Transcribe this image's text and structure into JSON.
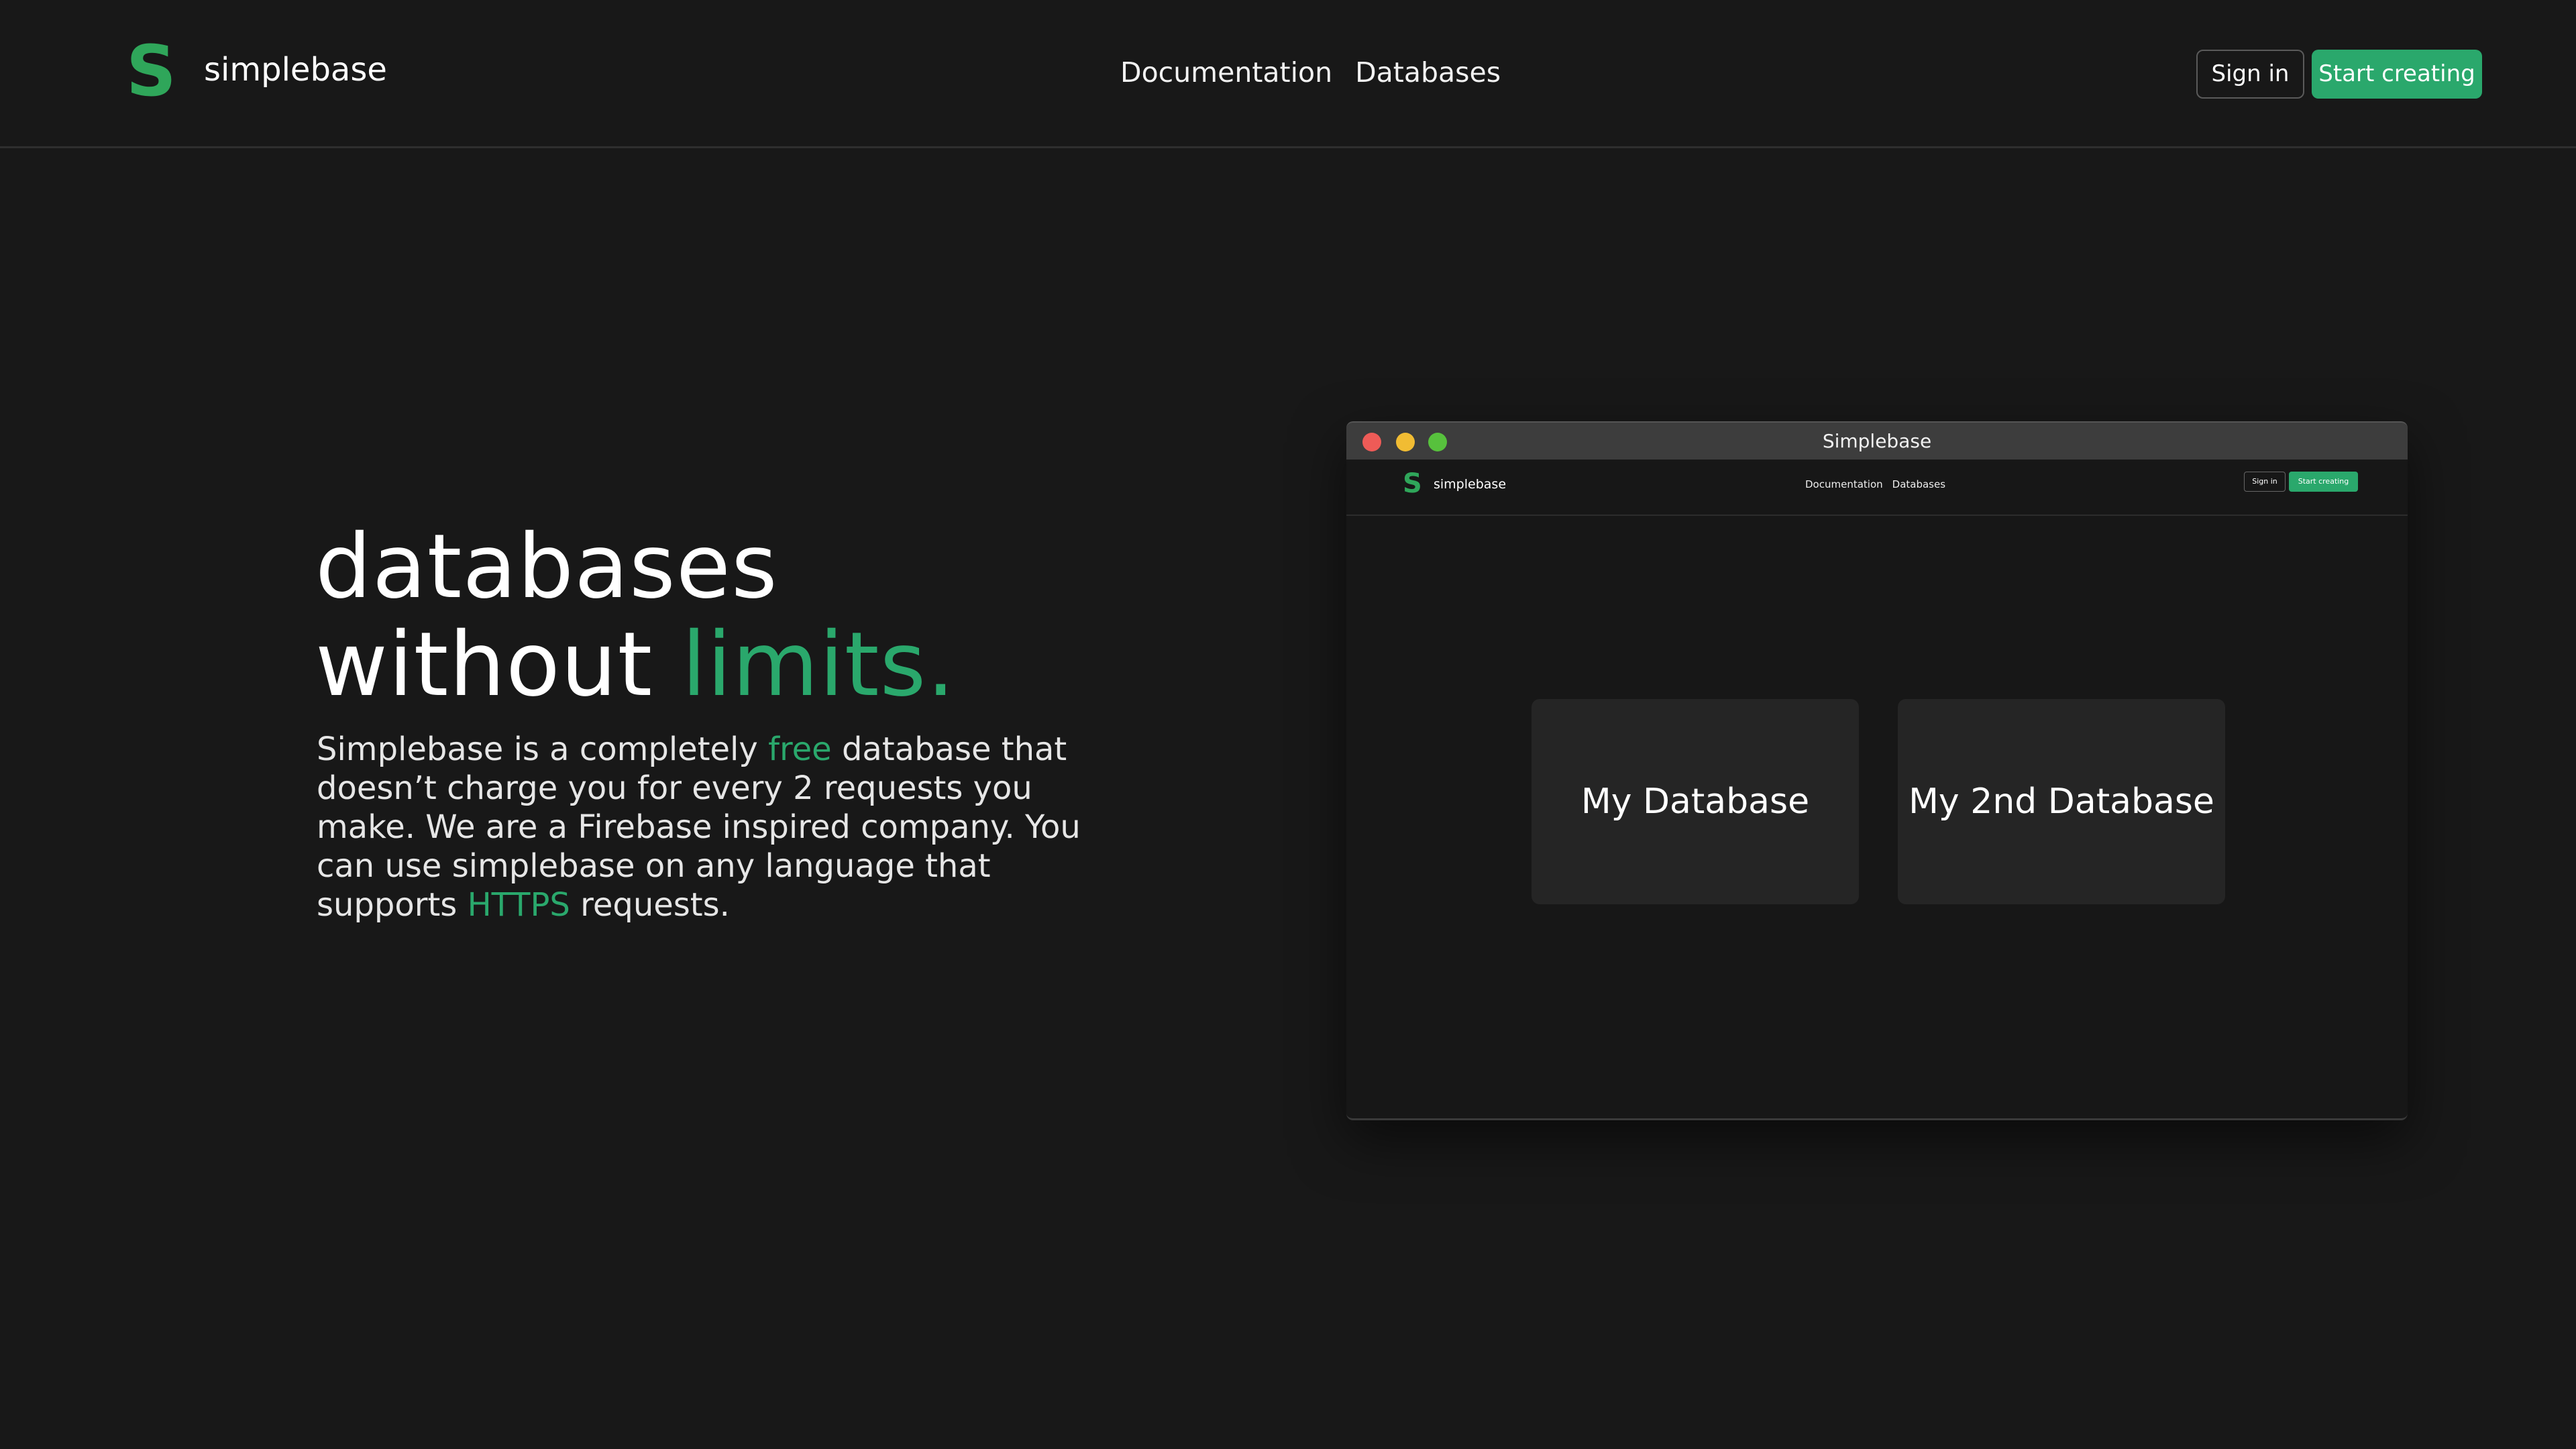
{
  "nav": {
    "logo_mark": "S",
    "brand": "simplebase",
    "links": [
      "Documentation",
      "Databases"
    ],
    "sign_in": "Sign in",
    "start_creating": "Start creating"
  },
  "hero": {
    "title_line1": "databases",
    "title_line2_prefix": "without ",
    "title_line2_accent": "limits.",
    "desc_part1": "Simplebase is a completely ",
    "desc_free": "free",
    "desc_part2": " database that doesn’t charge you for every 2 requests you make. We are a Firebase inspired company. You can use simplebase on any language that supports ",
    "desc_https": "HTTPS",
    "desc_part3": " requests."
  },
  "mockup": {
    "window_title": "Simplebase",
    "nav": {
      "logo_mark": "S",
      "brand": "simplebase",
      "links": [
        "Documentation",
        "Databases"
      ],
      "sign_in": "Sign in",
      "start_creating": "Start creating"
    },
    "databases": [
      "My Database",
      "My 2nd Database"
    ]
  },
  "colors": {
    "background": "#181818",
    "accent": "#2aa86c",
    "logo": "#2fa65a",
    "card": "#252525"
  }
}
